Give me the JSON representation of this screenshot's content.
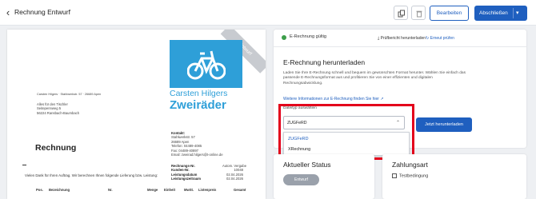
{
  "header": {
    "back_icon": "chevron-left-icon",
    "title": "Rechnung Entwurf",
    "copy_icon": "copy-icon",
    "delete_icon": "trash-icon",
    "edit_label": "Bearbeiten",
    "finish_label": "Abschließen",
    "finish_menu_icon": "chevron-down-icon"
  },
  "invoice_preview": {
    "ribbon": "Entwurf",
    "logo_icon": "bicycle-icon",
    "brand_line1": "Carsten Hilgers",
    "brand_line2": "Zweiräder",
    "sender_line": "Carsten Hilgers · Stahlwerkstr. 57 · 26689 Apen",
    "recipient": [
      "Alles für den Tischler",
      "Seitepennweg 5",
      "56224 Ransbach-Baumbach"
    ],
    "contact_heading": "Kontakt:",
    "contact_lines": [
      "Stahlwerkstr. 57",
      "26689 Apen",
      "Telefon: 04489-4085",
      "Fax: 04489-40897",
      "Email: zweirad.hilgers@t-online.de"
    ],
    "meta": [
      {
        "label": "Rechnungs-Nr.",
        "value": "Autom. Vergabe"
      },
      {
        "label": "Kunden-Nr.",
        "value": "10048"
      },
      {
        "label": "Leistungsdatum",
        "value": "02.04.2026"
      },
      {
        "label": "Leistungszeitraum",
        "value": "02.04.2026"
      }
    ],
    "heading": "Rechnung",
    "intro": "Vielen Dank für Ihren Auftrag. Wir berechnen Ihnen folgende Lieferung bzw. Leistung:",
    "columns": [
      "Pos.",
      "Bezeichnung",
      "Nr.",
      "Menge",
      "Einheit",
      "MwSt.",
      "Listenpreis",
      "Gesamt"
    ]
  },
  "erechnung": {
    "status_icon": "check-circle-icon",
    "status": "E-Rechnung gültig",
    "download_report": "Prüfbericht herunterladen",
    "retry": "Erneut prüfen",
    "title": "E-Rechnung herunterladen",
    "description": "Laden Sie Ihre E-Rechnung schnell und bequem im gewünschten Format herunter. Wählen Sie einfach das passende E-Rechnungsformat aus und profitieren Sie von einer effizienten und digitalen Rechnungsabwicklung.",
    "more_info": "Weitere Informationen zur E-Rechnung finden Sie hier",
    "filetype_label": "Dateityp auswählen",
    "selected": "ZUGFeRD",
    "options": [
      "ZUGFeRD",
      "XRechnung"
    ],
    "download_button": "Jetzt herunterladen"
  },
  "status_card": {
    "title": "Aktueller Status",
    "status": "Entwurf"
  },
  "payment_card": {
    "title": "Zahlungsart",
    "item_icon": "document-icon",
    "item": "Testbedingung"
  }
}
